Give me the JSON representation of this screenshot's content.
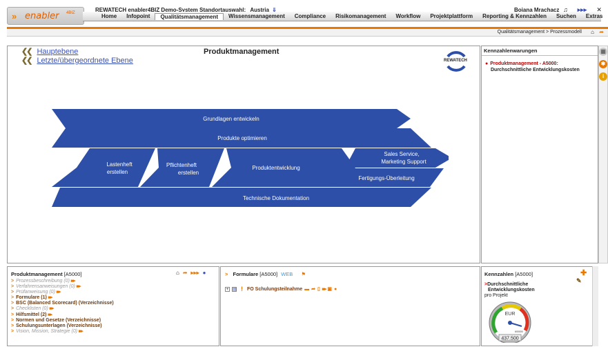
{
  "header": {
    "app_name": "enabler",
    "app_sup": "4BIZ",
    "title": "REWATECH enabler4BIZ Demo-System Standortauswahl:",
    "country": "Austria",
    "user": "Bojana Mrachacz"
  },
  "menu": [
    "Home",
    "Infopoint",
    "Qualitätsmanagement",
    "Wissensmanagement",
    "Compliance",
    "Risikomanagement",
    "Workflow",
    "Projektplattform",
    "Reporting & Kennzahlen",
    "Suchen",
    "Extras"
  ],
  "breadcrumb": "Qualitätsmanagement > Prozessmodell",
  "main": {
    "nav": [
      "Hauptebene",
      "Letzte/übergeordnete Ebene"
    ],
    "title": "Produktmanagement",
    "logo_text": "REWATECH"
  },
  "diagram": {
    "rows": [
      "Grundlagen entwickeln",
      "Produkte optimieren",
      "Technische Dokumentation"
    ],
    "steps": [
      "Lastenheft erstellen",
      "Pflichtenheft erstellen",
      "Produktentwicklung"
    ],
    "step1_lines": [
      "Lastenheft",
      "erstellen"
    ],
    "step2_lines": [
      "Pflichtenheft",
      "erstellen"
    ],
    "right_top_lines": [
      "Sales Service,",
      "Marketing Support"
    ],
    "right_bottom": "Fertigungs-Überleitung"
  },
  "warnings": {
    "title": "Kennzahlenwarungen",
    "line1": "Produktmanagement - A5000:",
    "line2": "Durchschnittliche Entwicklungskosten"
  },
  "process_panel": {
    "title": "Produktmanagement",
    "code": "[A5000]",
    "items": [
      {
        "label": "Prozessbeschreibung (0)",
        "style": "dim"
      },
      {
        "label": "Verfahrensanweisungen (0)",
        "style": "dim"
      },
      {
        "label": "Prüfanweisung (0)",
        "style": "dim"
      },
      {
        "label": "Formulare (1)",
        "style": "strong"
      },
      {
        "label": "BSC (Balanced Scorecard) (Verzeichnisse)",
        "style": "strong"
      },
      {
        "label": "Checklisten (0)",
        "style": "dim"
      },
      {
        "label": "Hilfsmittel (2)",
        "style": "strong"
      },
      {
        "label": "Normen und Gesetze (Verzeichnisse)",
        "style": "strong"
      },
      {
        "label": "Schulungsunterlagen (Verzeichnisse)",
        "style": "strong"
      },
      {
        "label": "Vision, Mission, Strategie (0)",
        "style": "dim"
      }
    ]
  },
  "forms_panel": {
    "title": "Formulare",
    "code": "[A5000]",
    "web": "WEB",
    "form": "FO Schulungsteilnahme"
  },
  "kpi_panel": {
    "title": "Kennzahlen",
    "code": "[A5000]",
    "item_line1": "Durchschnittliche",
    "item_line2": "Entwicklungskosten",
    "sub": "pro Projekt",
    "currency": "EUR",
    "value": "437.500",
    "scale_label": "600000"
  },
  "colors": {
    "arrow_blue": "#2d4fa8",
    "accent_orange": "#e87800"
  }
}
